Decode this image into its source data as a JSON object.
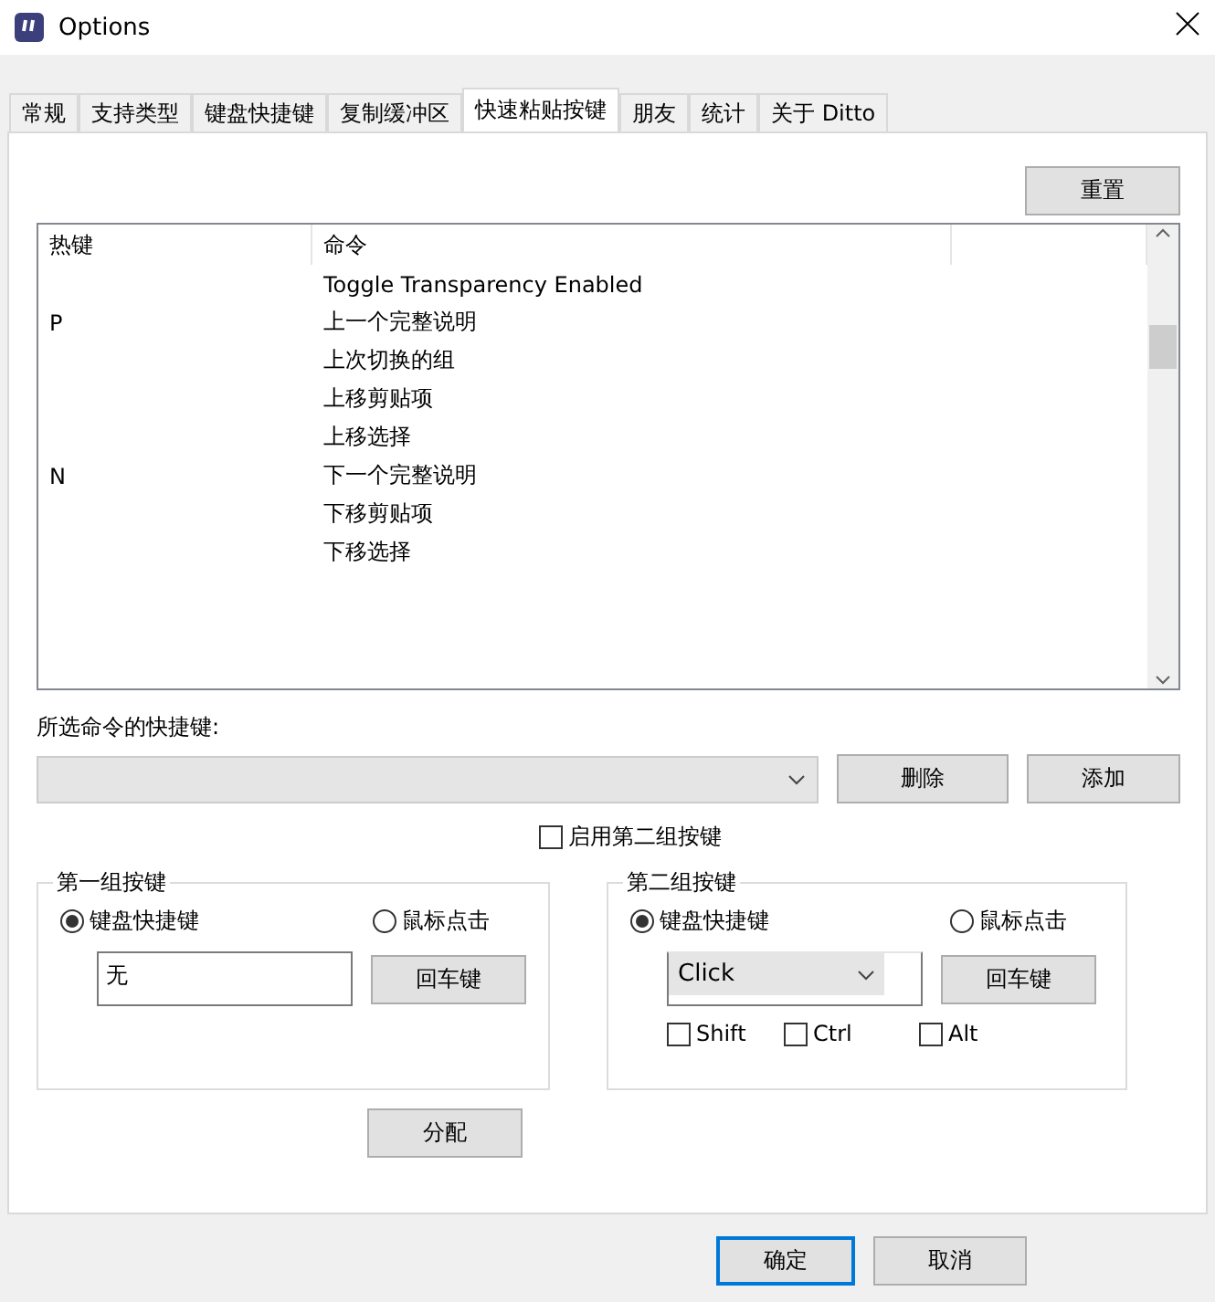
{
  "window": {
    "title": "Options"
  },
  "tabs": [
    {
      "label": "常规",
      "selected": false
    },
    {
      "label": "支持类型",
      "selected": false
    },
    {
      "label": "键盘快捷键",
      "selected": false
    },
    {
      "label": "复制缓冲区",
      "selected": false
    },
    {
      "label": "快速粘贴按键",
      "selected": true
    },
    {
      "label": "朋友",
      "selected": false
    },
    {
      "label": "统计",
      "selected": false
    },
    {
      "label": "关于 Ditto",
      "selected": false
    }
  ],
  "reset_button": "重置",
  "table": {
    "columns": [
      "热键",
      "命令"
    ],
    "rows": [
      {
        "hotkey": "",
        "command": "Toggle Transparency Enabled"
      },
      {
        "hotkey": "P",
        "command": "上一个完整说明"
      },
      {
        "hotkey": "",
        "command": "上次切换的组"
      },
      {
        "hotkey": "",
        "command": "上移剪贴项"
      },
      {
        "hotkey": "",
        "command": "上移选择"
      },
      {
        "hotkey": "N",
        "command": "下一个完整说明"
      },
      {
        "hotkey": "",
        "command": "下移剪贴项"
      },
      {
        "hotkey": "",
        "command": "下移选择"
      }
    ]
  },
  "shortcut_label": "所选命令的快捷键:",
  "shortcut_buttons": [
    "删除",
    "添加"
  ],
  "second_group_toggle": {
    "label": "启用第二组按键",
    "checked": false
  },
  "groups": [
    {
      "title": "第一组按键",
      "options": [
        {
          "label": "键盘快捷键",
          "selected": true
        },
        {
          "label": "鼠标点击",
          "selected": false
        }
      ],
      "kind": "text",
      "value": "无",
      "enter_button": "回车键"
    },
    {
      "title": "第二组按键",
      "options": [
        {
          "label": "键盘快捷键",
          "selected": true
        },
        {
          "label": "鼠标点击",
          "selected": false
        }
      ],
      "kind": "select",
      "value": "Click",
      "enter_button": "回车键",
      "modifiers": [
        {
          "label": "Shift",
          "checked": false
        },
        {
          "label": "Ctrl",
          "checked": false
        },
        {
          "label": "Alt",
          "checked": false
        }
      ]
    }
  ],
  "assign_button": "分配",
  "dialog_buttons": [
    {
      "label": "确定",
      "default": true
    },
    {
      "label": "取消",
      "default": false
    }
  ]
}
